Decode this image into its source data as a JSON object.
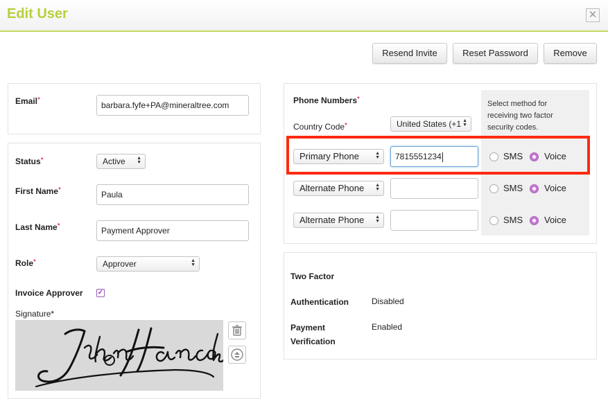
{
  "dialog": {
    "title": "Edit User",
    "close_icon": "close-icon"
  },
  "actions": {
    "resend_invite": "Resend Invite",
    "reset_password": "Reset Password",
    "remove": "Remove"
  },
  "email": {
    "label": "Email",
    "value": "barbara.fyfe+PA@mineraltree.com"
  },
  "user": {
    "status_label": "Status",
    "status_value": "Active",
    "first_name_label": "First Name",
    "first_name_value": "Paula",
    "last_name_label": "Last Name",
    "last_name_value": "Payment Approver",
    "role_label": "Role",
    "role_value": "Approver",
    "invoice_approver_label": "Invoice Approver",
    "invoice_approver_checked": true,
    "signature_label": "Signature*",
    "signature_text": "John Hancock"
  },
  "phone": {
    "title": "Phone Numbers",
    "country_code_label": "Country Code",
    "country_code_value": "United States (+1",
    "method_help": "Select method for receiving two factor security codes.",
    "rows": [
      {
        "type": "Primary Phone",
        "number": "7815551234",
        "sms": "SMS",
        "voice": "Voice",
        "selected": "Voice"
      },
      {
        "type": "Alternate Phone",
        "number": "",
        "sms": "SMS",
        "voice": "Voice",
        "selected": "Voice"
      },
      {
        "type": "Alternate Phone",
        "number": "",
        "sms": "SMS",
        "voice": "Voice",
        "selected": "Voice"
      }
    ]
  },
  "two_factor": {
    "title": "Two Factor",
    "authentication_label": "Authentication",
    "authentication_value": "Disabled",
    "payment_label": "Payment",
    "payment_label_2": "Verification",
    "payment_value": "Enabled"
  },
  "colors": {
    "accent_green": "#b8cf3c",
    "highlight_red": "#ff2a12",
    "radio_purple": "#c27bd0"
  }
}
